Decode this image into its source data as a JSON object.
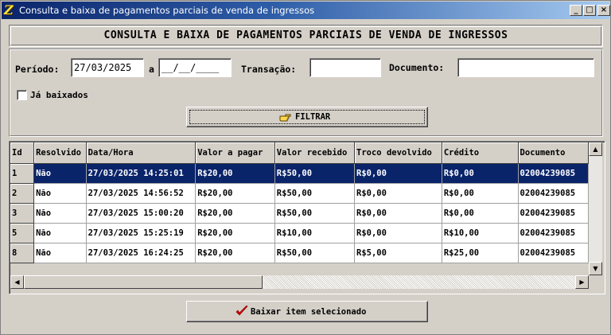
{
  "window": {
    "title": "Consulta e baixa de pagamentos parciais de venda de ingressos",
    "controls": {
      "minimize": "_",
      "maximize": "□",
      "close": "×"
    }
  },
  "header": {
    "title": "CONSULTA E BAIXA DE PAGAMENTOS PARCIAIS DE VENDA DE INGRESSOS"
  },
  "filters": {
    "periodo_label": "Período:",
    "periodo_start": "27/03/2025",
    "periodo_sep": "a",
    "periodo_end": "__/__/____",
    "transacao_label": "Transação:",
    "transacao_value": "",
    "documento_label": "Documento:",
    "documento_value": "",
    "ja_baixados_label": "Já baixados",
    "ja_baixados_checked": false,
    "filter_button": "FILTRAR"
  },
  "grid": {
    "columns": [
      "Id",
      "Resolvido",
      "Data/Hora",
      "Valor a pagar",
      "Valor recebido",
      "Troco devolvido",
      "Crédito",
      "Documento"
    ],
    "rows": [
      {
        "id": "1",
        "resolvido": "Não",
        "datahora": "27/03/2025 14:25:01",
        "valor_pagar": "R$20,00",
        "valor_recebido": "R$50,00",
        "troco": "R$0,00",
        "credito": "R$0,00",
        "documento": "02004239085"
      },
      {
        "id": "2",
        "resolvido": "Não",
        "datahora": "27/03/2025 14:56:52",
        "valor_pagar": "R$20,00",
        "valor_recebido": "R$50,00",
        "troco": "R$0,00",
        "credito": "R$0,00",
        "documento": "02004239085"
      },
      {
        "id": "3",
        "resolvido": "Não",
        "datahora": "27/03/2025 15:00:20",
        "valor_pagar": "R$20,00",
        "valor_recebido": "R$50,00",
        "troco": "R$0,00",
        "credito": "R$0,00",
        "documento": "02004239085"
      },
      {
        "id": "5",
        "resolvido": "Não",
        "datahora": "27/03/2025 15:25:19",
        "valor_pagar": "R$20,00",
        "valor_recebido": "R$10,00",
        "troco": "R$0,00",
        "credito": "R$10,00",
        "documento": "02004239085"
      },
      {
        "id": "8",
        "resolvido": "Não",
        "datahora": "27/03/2025 16:24:25",
        "valor_pagar": "R$20,00",
        "valor_recebido": "R$50,00",
        "troco": "R$5,00",
        "credito": "R$25,00",
        "documento": "02004239085"
      }
    ],
    "selected_row": 0
  },
  "footer": {
    "baixar_button": "Baixar item selecionado"
  },
  "colors": {
    "title_start": "#0a246a",
    "title_end": "#a6caf0",
    "selection": "#0a246a",
    "face": "#d4d0c8",
    "check_red": "#d40000"
  },
  "icons": {
    "app": "app-logo-icon",
    "filter": "pointing-hand-icon",
    "baixar": "red-checkmark-icon"
  }
}
